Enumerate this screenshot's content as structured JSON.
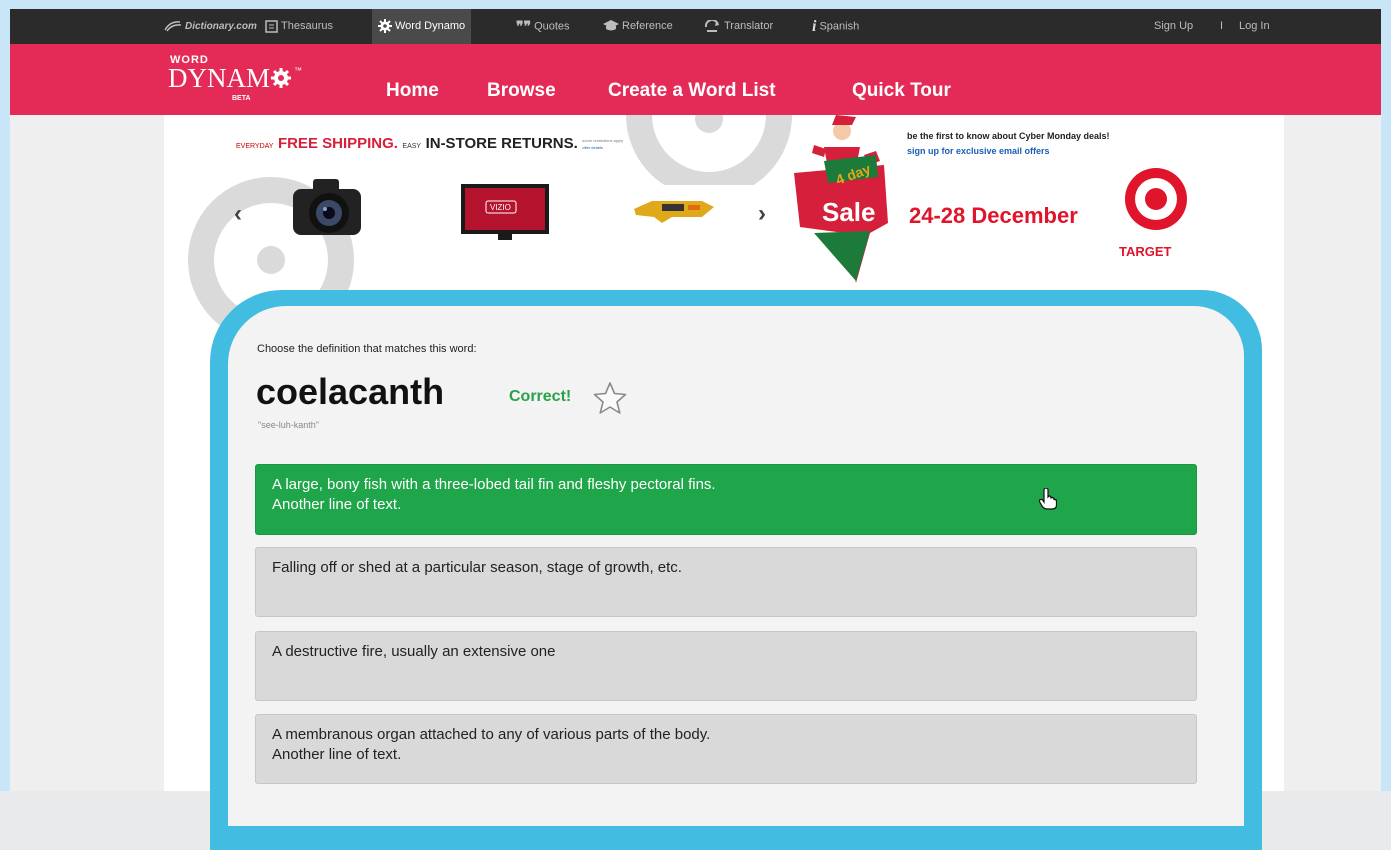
{
  "topbar": {
    "items": [
      {
        "label": "Dictionary.com",
        "icon": "dictionary-logo-icon"
      },
      {
        "label": "Thesaurus",
        "icon": "thesaurus-icon"
      },
      {
        "label": "Word Dynamo",
        "icon": "gear-icon",
        "active": true
      },
      {
        "label": "Quotes",
        "icon": "quote-icon"
      },
      {
        "label": "Reference",
        "icon": "mortarboard-icon"
      },
      {
        "label": "Translator",
        "icon": "translator-icon"
      },
      {
        "label": "Spanish",
        "icon": "info-i-icon"
      }
    ],
    "sign_up": "Sign Up",
    "separator": "I",
    "log_in": "Log In"
  },
  "header": {
    "logo_word": "WORD",
    "logo_dynamo": "DYNAM",
    "logo_tm": "™",
    "logo_beta": "BETA",
    "nav": [
      "Home",
      "Browse",
      "Create a Word List",
      "Quick Tour"
    ]
  },
  "ad": {
    "everyday": "EVERYDAY",
    "free_shipping": "FREE SHIPPING",
    "easy": "EASY",
    "in_store_returns": "IN-STORE RETURNS",
    "restrictions": "some restrictions apply",
    "offer_details": "offer details",
    "product_tv_brand": "VIZIO",
    "sale_day": "4 day",
    "sale_word": "Sale",
    "promo_line1": "be the first to know about Cyber Monday deals!",
    "promo_line2": "sign up for exclusive email offers",
    "dates": "24-28 December",
    "brand": "TARGET"
  },
  "quiz": {
    "prompt": "Choose the definition that matches this word:",
    "word": "coelacanth",
    "status": "Correct!",
    "pronunciation": "\"see-luh-kanth\"",
    "options": [
      {
        "line1": "A large, bony fish with a three-lobed tail fin and fleshy pectoral fins.",
        "line2": "Another line of text.",
        "selected": true
      },
      {
        "line1": "Falling off or shed at a particular season, stage of growth, etc.",
        "line2": "",
        "selected": false
      },
      {
        "line1": "A destructive fire, usually an extensive one",
        "line2": "",
        "selected": false
      },
      {
        "line1": "A membranous organ attached to any of various parts of the body.",
        "line2": "Another line of text.",
        "selected": false
      }
    ]
  },
  "colors": {
    "header_red": "#e42b58",
    "topbar_dark": "#2b2b2b",
    "card_border_blue": "#42bce0",
    "correct_green": "#1fa64a",
    "target_red": "#e0142b"
  }
}
